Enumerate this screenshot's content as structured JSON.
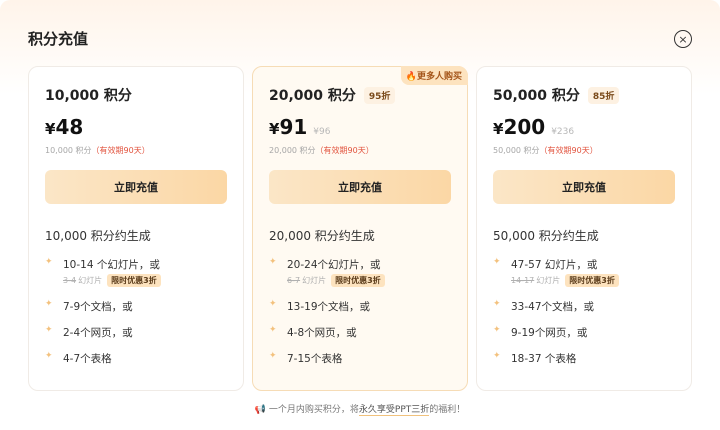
{
  "modal": {
    "title": "积分充值",
    "close_icon": "×"
  },
  "plans": [
    {
      "name": "10,000 积分",
      "discount": "",
      "currency": "¥",
      "price": "48",
      "original_price": "",
      "points_text": "10,000 积分",
      "validity": "（有效期90天）",
      "button": "立即充值",
      "gen_title": "10,000 积分约生成",
      "features": [
        {
          "text": "10-14 个幻灯片，或",
          "strike": "3-4",
          "strike_unit": "幻灯片",
          "promo": "限时优惠3折"
        },
        {
          "text": "7-9个文档，或"
        },
        {
          "text": "2-4个网页，或"
        },
        {
          "text": "4-7个表格"
        }
      ]
    },
    {
      "name": "20,000 积分",
      "discount": "95折",
      "hot_tag": "🔥更多人购买",
      "currency": "¥",
      "price": "91",
      "original_price": "¥96",
      "points_text": "20,000 积分",
      "validity": "（有效期90天）",
      "button": "立即充值",
      "gen_title": "20,000 积分约生成",
      "features": [
        {
          "text": "20-24个幻灯片，或",
          "strike": "6-7",
          "strike_unit": "幻灯片",
          "promo": "限时优惠3折"
        },
        {
          "text": "13-19个文档，或"
        },
        {
          "text": "4-8个网页，或"
        },
        {
          "text": "7-15个表格"
        }
      ]
    },
    {
      "name": "50,000 积分",
      "discount": "85折",
      "currency": "¥",
      "price": "200",
      "original_price": "¥236",
      "points_text": "50,000 积分",
      "validity": "（有效期90天）",
      "button": "立即充值",
      "gen_title": "50,000 积分约生成",
      "features": [
        {
          "text": "47-57 幻灯片，或",
          "strike": "14-17",
          "strike_unit": "幻灯片",
          "promo": "限时优惠3折"
        },
        {
          "text": "33-47个文档，或"
        },
        {
          "text": "9-19个网页，或"
        },
        {
          "text": "18-37 个表格"
        }
      ]
    }
  ],
  "footer": {
    "icon": "📢",
    "prefix": "一个月内购买积分，将",
    "highlight": "永久享受PPT三折",
    "suffix": "的福利！"
  },
  "colors": {
    "accent_button": "#fbd7a5",
    "featured_border": "#f6dcb6",
    "validity_red": "#e2533e"
  },
  "icons": [
    "close-icon",
    "fire-icon",
    "sparkle-icon",
    "megaphone-icon"
  ]
}
